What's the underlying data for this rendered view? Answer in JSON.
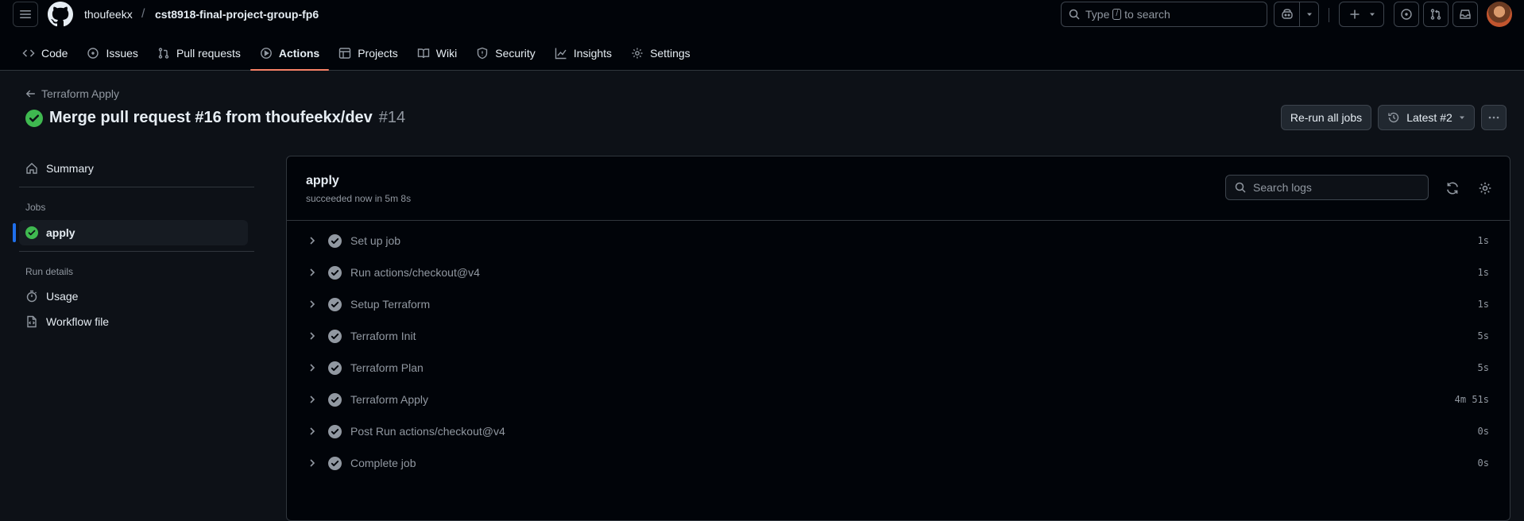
{
  "header": {
    "owner": "thoufeekx",
    "repo": "cst8918-final-project-group-fp6",
    "search_prefix": "Type",
    "search_key": "/",
    "search_suffix": "to search"
  },
  "tabs": [
    {
      "label": "Code",
      "icon": "code-icon"
    },
    {
      "label": "Issues",
      "icon": "issue-icon"
    },
    {
      "label": "Pull requests",
      "icon": "pull-request-icon"
    },
    {
      "label": "Actions",
      "icon": "play-icon",
      "active": true
    },
    {
      "label": "Projects",
      "icon": "table-icon"
    },
    {
      "label": "Wiki",
      "icon": "book-icon"
    },
    {
      "label": "Security",
      "icon": "shield-icon"
    },
    {
      "label": "Insights",
      "icon": "graph-icon"
    },
    {
      "label": "Settings",
      "icon": "gear-icon"
    }
  ],
  "run": {
    "back_label": "Terraform Apply",
    "title": "Merge pull request #16 from thoufeekx/dev",
    "number": "#14",
    "rerun_label": "Re-run all jobs",
    "latest_label": "Latest #2"
  },
  "sidebar": {
    "summary": "Summary",
    "jobs_heading": "Jobs",
    "job": "apply",
    "run_details_heading": "Run details",
    "usage": "Usage",
    "workflow_file": "Workflow file"
  },
  "job": {
    "name": "apply",
    "status": "succeeded now in 5m 8s",
    "search_placeholder": "Search logs",
    "steps": [
      {
        "name": "Set up job",
        "duration": "1s"
      },
      {
        "name": "Run actions/checkout@v4",
        "duration": "1s"
      },
      {
        "name": "Setup Terraform",
        "duration": "1s"
      },
      {
        "name": "Terraform Init",
        "duration": "5s"
      },
      {
        "name": "Terraform Plan",
        "duration": "5s"
      },
      {
        "name": "Terraform Apply",
        "duration": "4m 51s"
      },
      {
        "name": "Post Run actions/checkout@v4",
        "duration": "0s"
      },
      {
        "name": "Complete job",
        "duration": "0s"
      }
    ]
  },
  "colors": {
    "success": "#3fb950",
    "accent": "#f78166",
    "selection": "#1f6feb"
  }
}
